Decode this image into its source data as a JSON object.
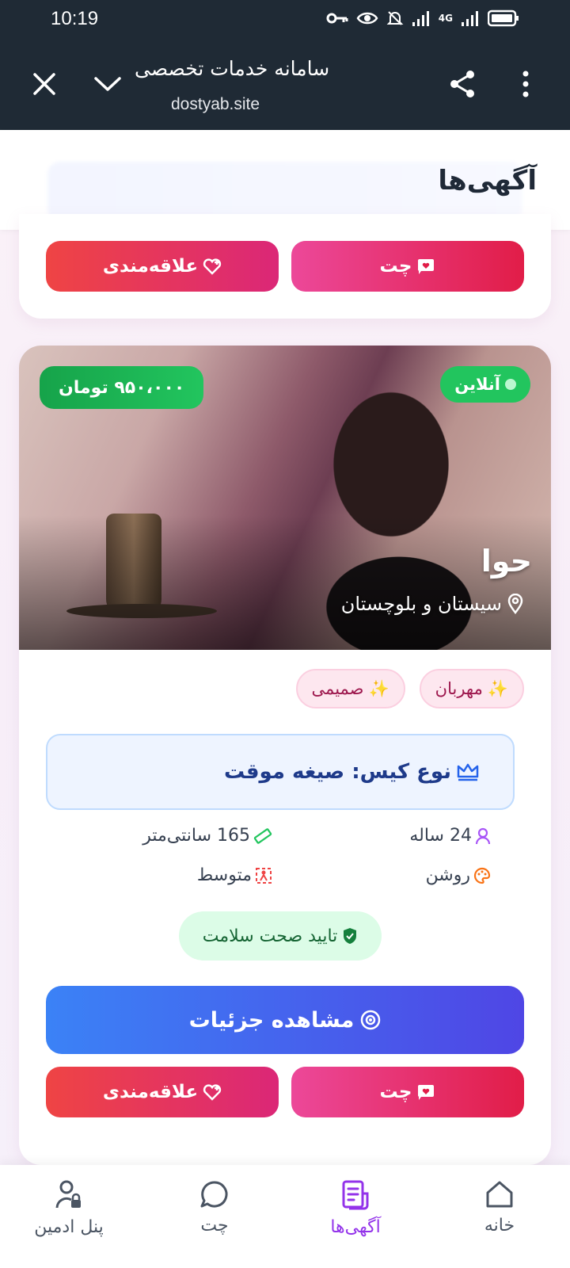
{
  "status_bar": {
    "time": "10:19",
    "network_label": "4G"
  },
  "browser": {
    "title": "سامانه خدمات تخصصی",
    "url": "dostyab.site",
    "close_icon": "close-icon",
    "collapse_icon": "chevron-down-icon",
    "share_icon": "share-icon",
    "menu_icon": "more-vertical-icon"
  },
  "page": {
    "title": "آگهی‌ها"
  },
  "top_card": {
    "fav_label": "علاقه‌مندی",
    "chat_label": "چت"
  },
  "listing": {
    "price": "۹۵۰،۰۰۰ تومان",
    "status": "آنلاین",
    "name": "حوا",
    "location": "سیستان و بلوچستان",
    "tags": [
      "مهربان",
      "صمیمی"
    ],
    "tag_icon": "✨",
    "case_type": "نوع کیس: صیغه موقت",
    "age": "24 ساله",
    "height": "165 سانتی‌متر",
    "skin": "روشن",
    "body": "متوسط",
    "health": "تایید صحت سلامت",
    "details_label": "مشاهده جزئیات",
    "fav_label": "علاقه‌مندی",
    "chat_label": "چت"
  },
  "bottom_nav": {
    "items": [
      {
        "label": "پنل ادمین",
        "icon": "user-lock-icon"
      },
      {
        "label": "چت",
        "icon": "chat-bubble-icon"
      },
      {
        "label": "آگهی‌ها",
        "icon": "document-list-icon",
        "active": true
      },
      {
        "label": "خانه",
        "icon": "home-icon"
      }
    ]
  },
  "colors": {
    "chrome_bg": "#1f2a35",
    "accent_purple": "#9333ea",
    "price_green": "#16a34a",
    "details_blue": "#3b82f6",
    "fav_red": "#ef4444",
    "chat_pink": "#ec4899"
  }
}
